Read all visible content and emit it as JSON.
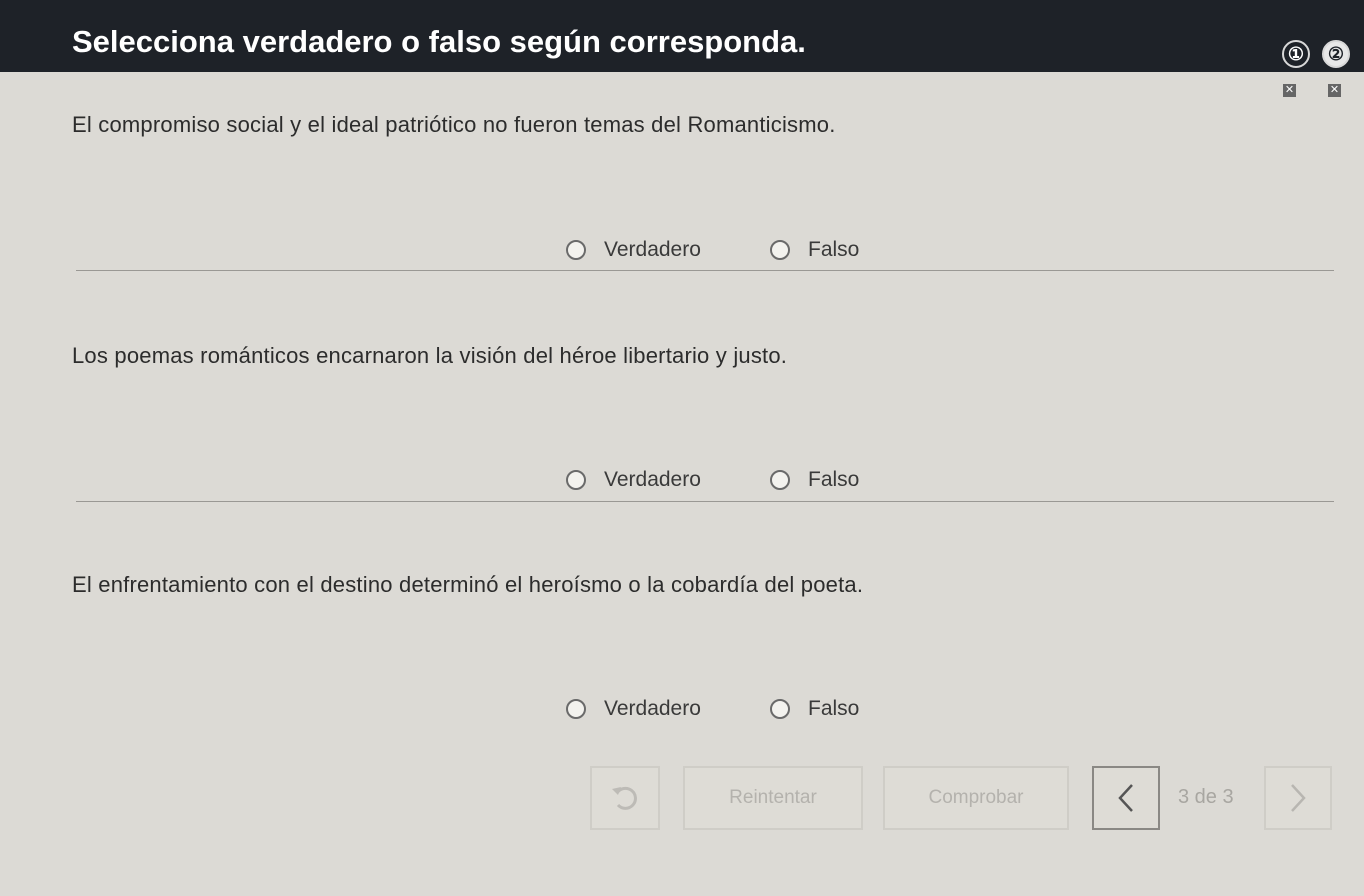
{
  "header": {
    "title": "Selecciona verdadero o falso según corresponda.",
    "nav": [
      {
        "label": "①"
      },
      {
        "label": "②"
      }
    ],
    "marks": [
      "✕",
      "✕"
    ]
  },
  "questions": [
    {
      "text": "El compromiso social y el ideal patriótico no fueron temas del Romanticismo.",
      "options": [
        "Verdadero",
        "Falso"
      ]
    },
    {
      "text": "Los poemas románticos encarnaron la visión del héroe libertario y justo.",
      "options": [
        "Verdadero",
        "Falso"
      ]
    },
    {
      "text": "El enfrentamiento con el destino determinó el heroísmo o la cobardía del poeta.",
      "options": [
        "Verdadero",
        "Falso"
      ]
    }
  ],
  "footer": {
    "undo_icon": "undo-icon",
    "retry_label": "Reintentar",
    "check_label": "Comprobar",
    "prev_icon": "chevron-left-icon",
    "page_text": "3 de 3",
    "next_icon": "chevron-right-icon"
  },
  "colors": {
    "header_bg": "#1e2228",
    "page_bg": "#dcdad5"
  }
}
